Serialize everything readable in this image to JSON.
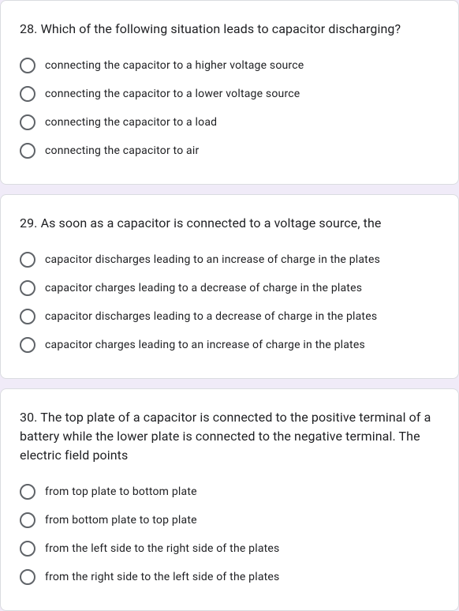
{
  "questions": [
    {
      "title": "28. Which of the following situation leads to capacitor discharging?",
      "options": [
        "connecting the capacitor to a higher voltage source",
        "connecting the capacitor to a lower voltage source",
        "connecting the capacitor to a load",
        "connecting the capacitor to air"
      ]
    },
    {
      "title": "29. As soon as a capacitor is connected to a voltage source, the",
      "options": [
        "capacitor discharges leading to an increase of charge in the plates",
        "capacitor charges leading to a decrease of charge in the plates",
        "capacitor discharges leading to a decrease of charge in the plates",
        "capacitor charges leading to an increase of charge in the plates"
      ]
    },
    {
      "title": "30. The top plate of a capacitor is connected to the positive terminal of a battery while the lower plate is connected to the negative terminal. The electric field points",
      "options": [
        "from top plate to bottom plate",
        "from bottom plate to top plate",
        "from the left side to the right side of the plates",
        "from the right side to the left side of the plates"
      ]
    }
  ]
}
